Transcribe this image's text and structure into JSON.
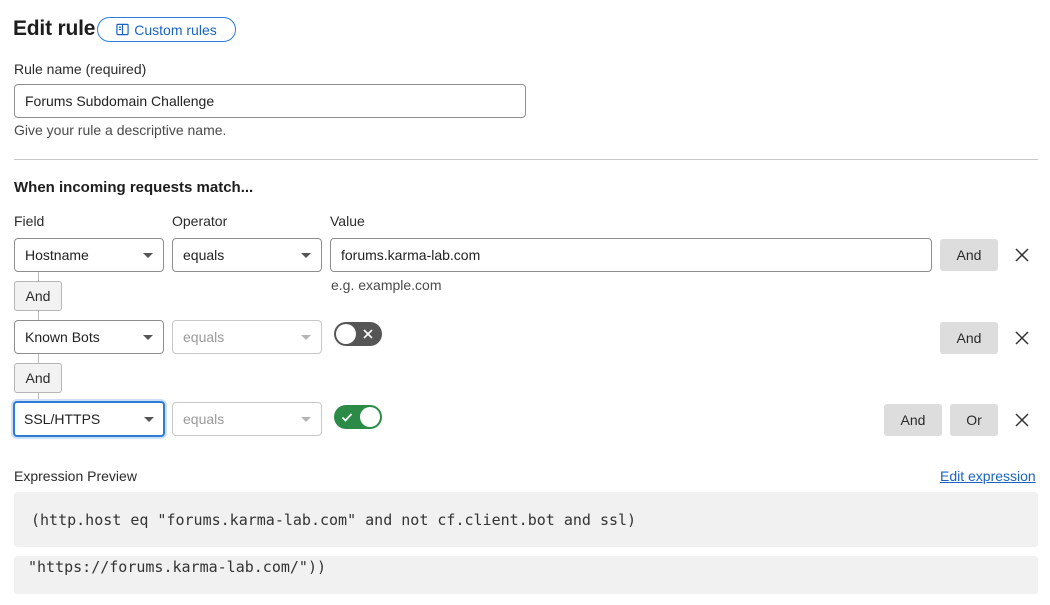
{
  "header": {
    "title": "Edit rule",
    "custom_rules_label": "Custom rules",
    "custom_rules_icon": "book-icon"
  },
  "rule_name": {
    "label": "Rule name (required)",
    "value": "Forums Subdomain Challenge",
    "help": "Give your rule a descriptive name."
  },
  "match": {
    "section_title": "When incoming requests match...",
    "columns": {
      "field": "Field",
      "operator": "Operator",
      "value": "Value"
    },
    "rows": [
      {
        "field": "Hostname",
        "operator": "equals",
        "value": "forums.karma-lab.com",
        "value_hint": "e.g. example.com",
        "buttons": [
          "And"
        ]
      },
      {
        "connector": "And",
        "field": "Known Bots",
        "operator": "equals",
        "toggle": "off",
        "buttons": [
          "And"
        ]
      },
      {
        "connector": "And",
        "field": "SSL/HTTPS",
        "operator": "equals",
        "toggle": "on",
        "buttons": [
          "And",
          "Or"
        ]
      }
    ]
  },
  "expression": {
    "label": "Expression Preview",
    "edit_link": "Edit expression",
    "line1": "(http.host eq \"forums.karma-lab.com\" and not cf.client.bot and ssl)",
    "line2": "\"https://forums.karma-lab.com/\"))"
  },
  "colors": {
    "accent": "#2c7cd6",
    "toggle_on": "#2a8a46",
    "toggle_off": "#555555"
  }
}
